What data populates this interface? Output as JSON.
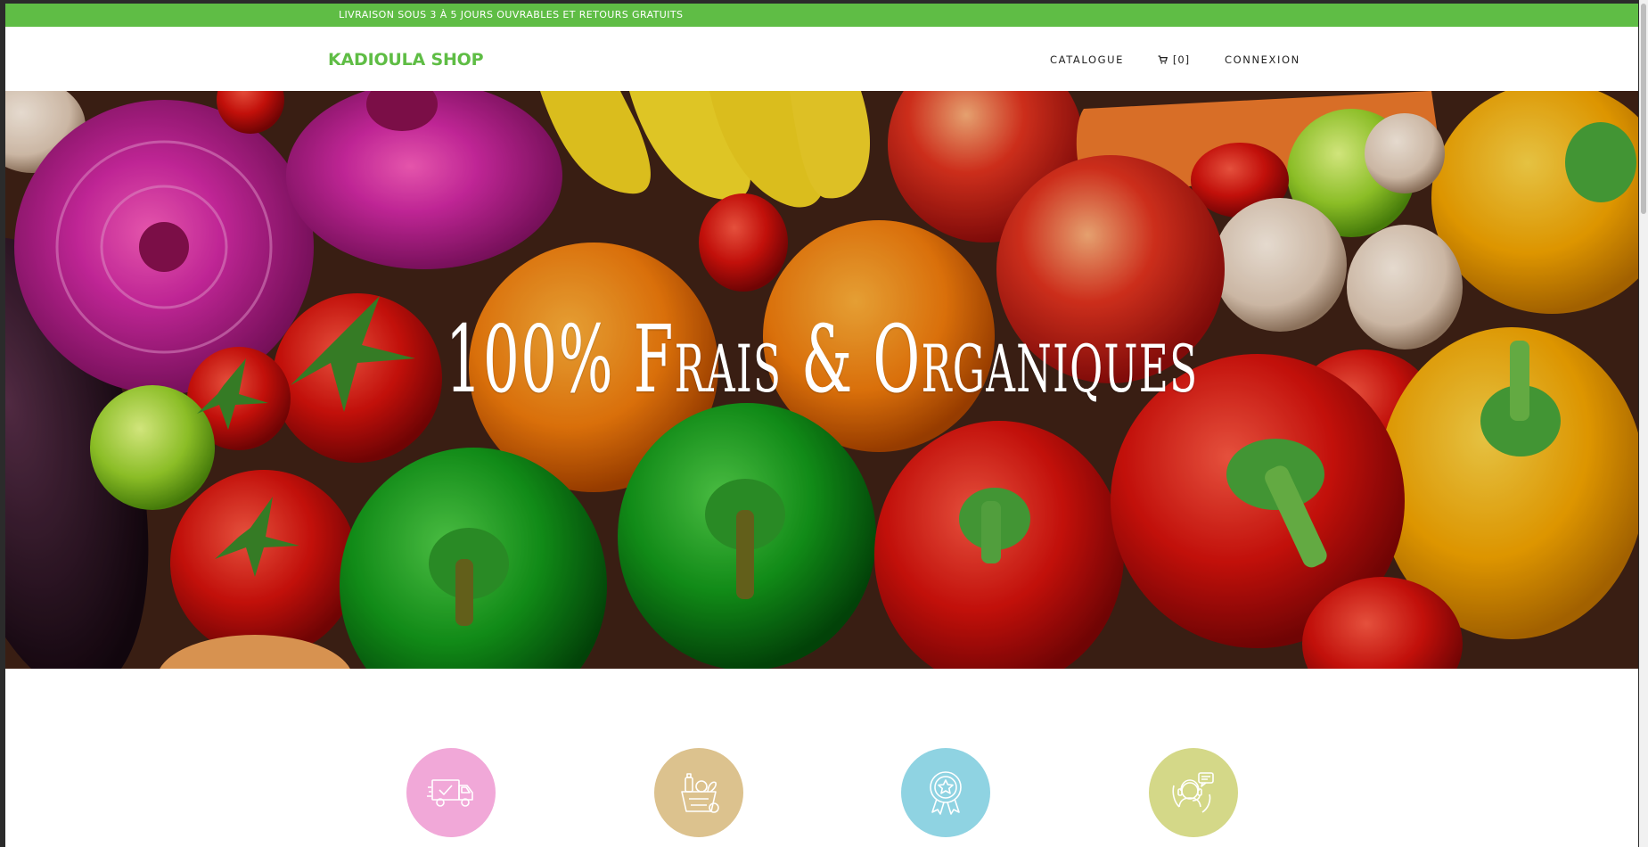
{
  "promo": {
    "text": "LIVRAISON SOUS 3 À 5 JOURS OUVRABLES ET RETOURS GRATUITS"
  },
  "header": {
    "brand": "KADIOULA SHOP",
    "nav": {
      "catalogue": "CATALOGUE",
      "cart_count": "[0]",
      "login": "CONNEXION"
    }
  },
  "hero": {
    "title_part1": "100% ",
    "title_part2": "Frais & Organiques"
  },
  "features": [
    {
      "icon": "delivery-truck-icon",
      "color": "#f1a8d8"
    },
    {
      "icon": "grocery-bag-icon",
      "color": "#dcc28e"
    },
    {
      "icon": "quality-badge-icon",
      "color": "#8fd3e2"
    },
    {
      "icon": "customer-support-icon",
      "color": "#d4d888"
    }
  ],
  "colors": {
    "brand_green": "#5fbd45",
    "text_dark": "#222222",
    "white": "#ffffff"
  }
}
